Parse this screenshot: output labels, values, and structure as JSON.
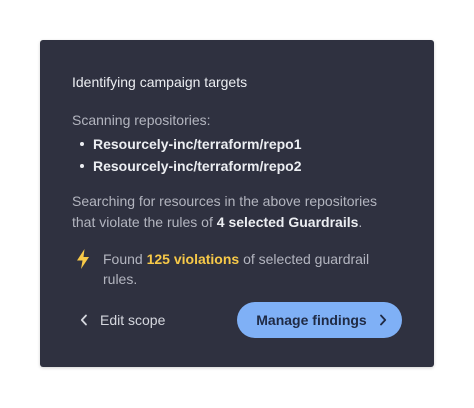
{
  "card": {
    "title": "Identifying campaign targets",
    "scan_label": "Scanning repositories:",
    "repositories": [
      "Resourcely-inc/terraform/repo1",
      "Resourcely-inc/terraform/repo2"
    ],
    "description": {
      "part1": "Searching for resources in the above repositories that violate the rules of ",
      "guardrails": "4 selected Guardrails",
      "part2": "."
    },
    "result": {
      "icon": "lightning-bolt-icon",
      "prefix": "Found ",
      "violations": "125 violations",
      "suffix": " of selected guardrail rules."
    },
    "actions": {
      "edit_scope_label": "Edit scope",
      "manage_findings_label": "Manage findings"
    }
  },
  "colors": {
    "card_bg": "#2f3140",
    "accent_button": "#7fb0f6",
    "highlight": "#f7c948"
  }
}
